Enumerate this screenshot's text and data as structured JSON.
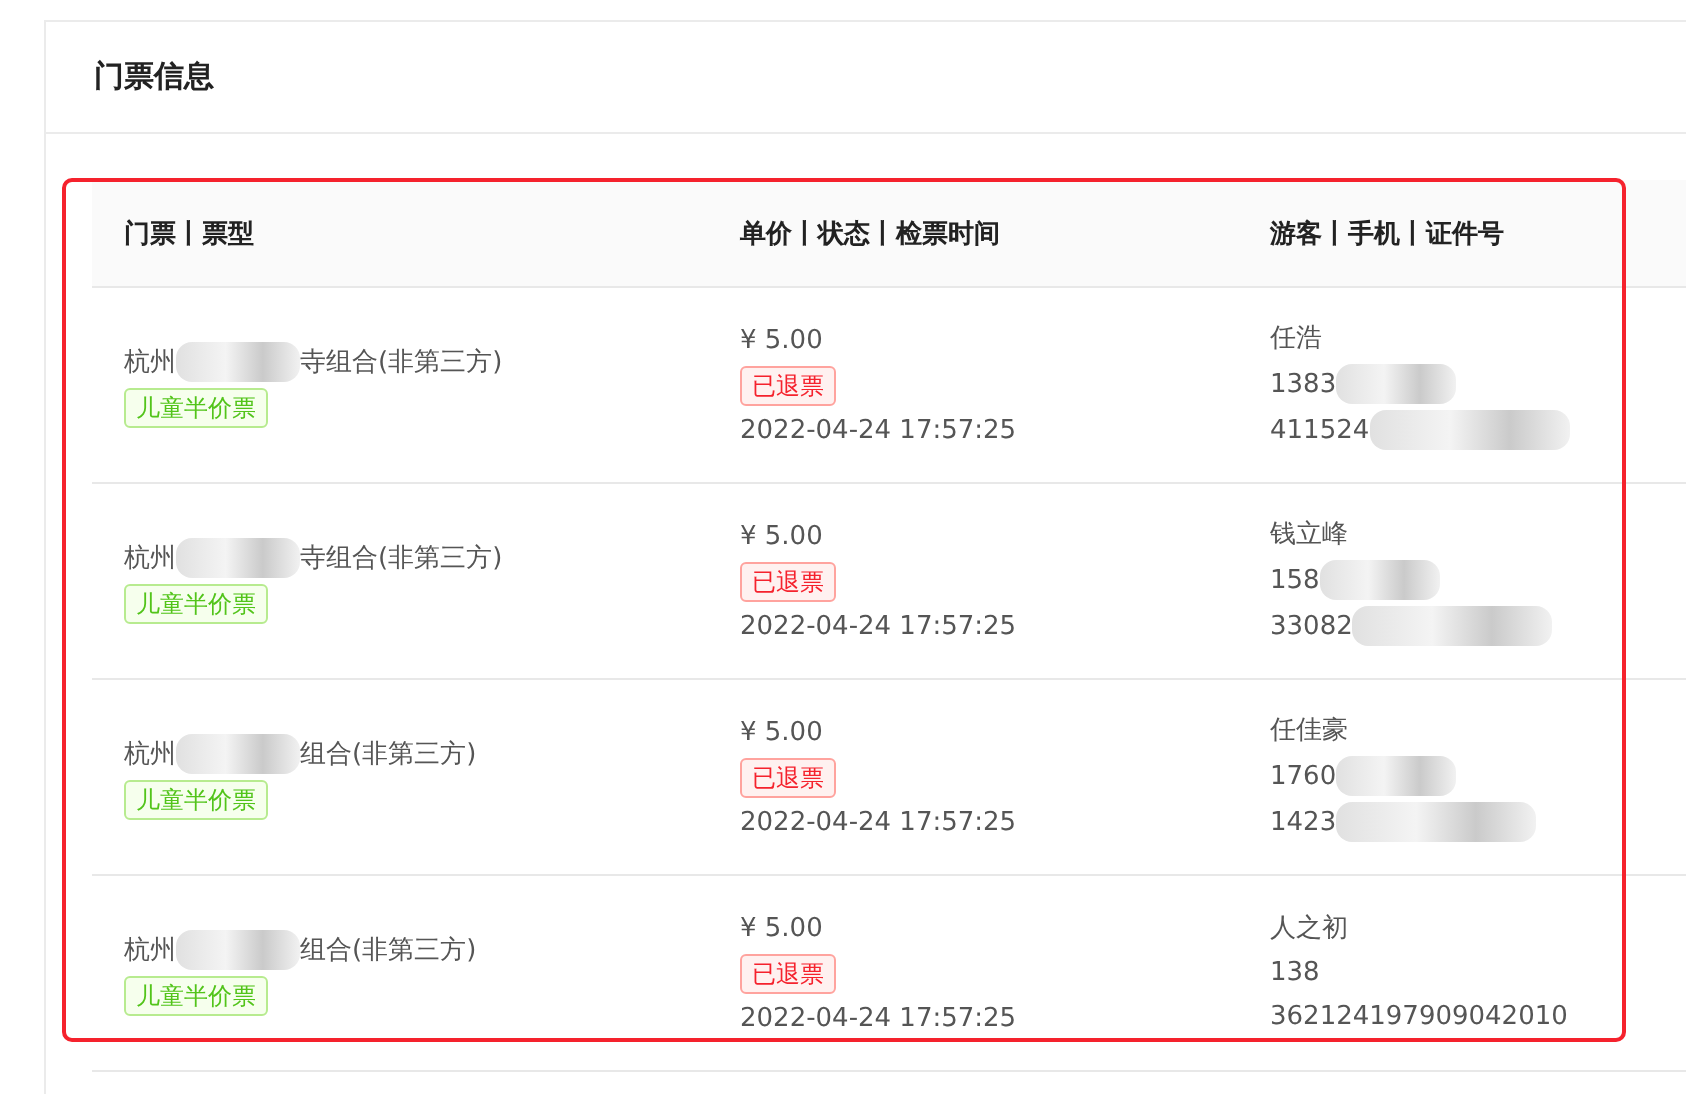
{
  "card": {
    "title": "门票信息"
  },
  "table": {
    "columns": [
      "门票丨票型",
      "单价丨状态丨检票时间",
      "游客丨手机丨证件号"
    ],
    "rows": [
      {
        "ticket_start": "杭州",
        "ticket_end": "寺组合(非第三方)",
        "ticket_type": "儿童半价票",
        "price": "¥ 5.00",
        "status": "已退票",
        "check_time": "2022-04-24 17:57:25",
        "visitor": "任浩",
        "phone": "1383",
        "id_number": "411524"
      },
      {
        "ticket_start": "杭州",
        "ticket_end": "寺组合(非第三方)",
        "ticket_type": "儿童半价票",
        "price": "¥ 5.00",
        "status": "已退票",
        "check_time": "2022-04-24 17:57:25",
        "visitor": "钱立峰",
        "phone": "158",
        "id_number": "33082"
      },
      {
        "ticket_start": "杭州",
        "ticket_end": "组合(非第三方)",
        "ticket_type": "儿童半价票",
        "price": "¥ 5.00",
        "status": "已退票",
        "check_time": "2022-04-24 17:57:25",
        "visitor": "任佳豪",
        "phone": "1760",
        "id_number": "1423"
      },
      {
        "ticket_start": "杭州",
        "ticket_end": "组合(非第三方)",
        "ticket_type": "儿童半价票",
        "price": "¥ 5.00",
        "status": "已退票",
        "check_time": "2022-04-24 17:57:25",
        "visitor": "人之初",
        "phone": "138",
        "id_number": "362124197909042010"
      }
    ]
  }
}
